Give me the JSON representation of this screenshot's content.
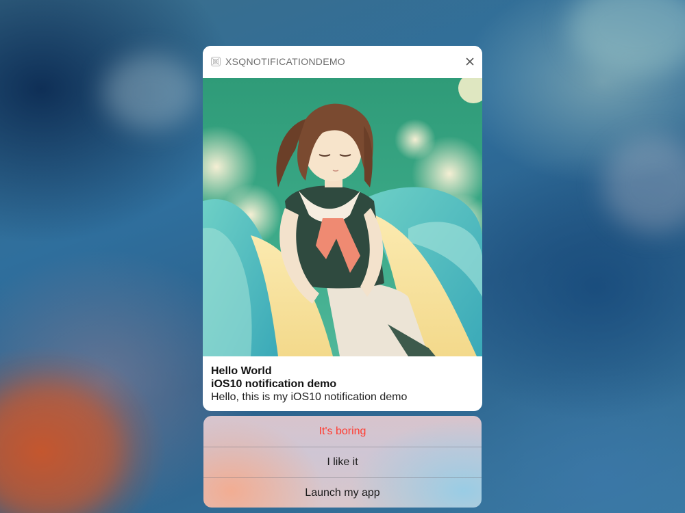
{
  "notification": {
    "app_name": "XSQNOTIFICATIONDEMO",
    "app_icon": "app-placeholder-icon",
    "close_icon": "close-icon",
    "attachment": "anime-girl-sailor-uniform-image",
    "title": "Hello World",
    "subtitle": "iOS10 notification demo",
    "message": "Hello, this is my iOS10 notification demo"
  },
  "actions": [
    {
      "label": "It's boring",
      "style": "destructive",
      "color": "#ff3b30"
    },
    {
      "label": "I like it",
      "style": "default",
      "color": "#1a1a1a"
    },
    {
      "label": "Launch my app",
      "style": "default",
      "color": "#1a1a1a"
    }
  ]
}
